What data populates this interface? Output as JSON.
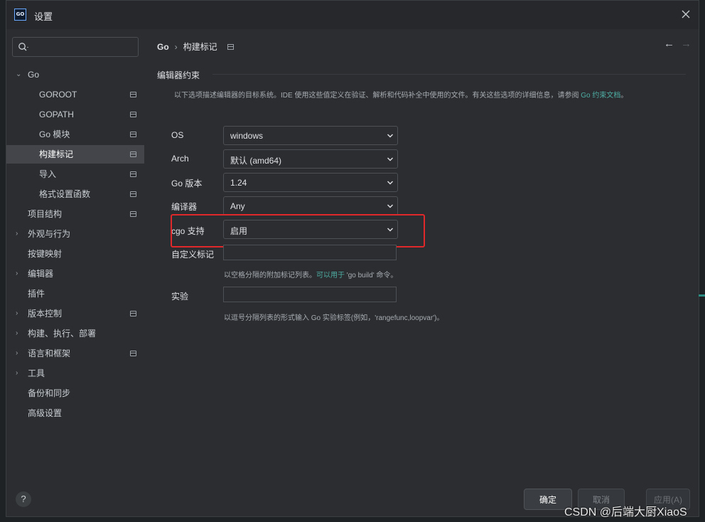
{
  "window": {
    "title": "设置",
    "app_icon_text": "GO"
  },
  "search": {
    "placeholder": ""
  },
  "sidebar": {
    "items": [
      {
        "label": "Go"
      },
      {
        "label": "GOROOT"
      },
      {
        "label": "GOPATH"
      },
      {
        "label": "Go 模块"
      },
      {
        "label": "构建标记"
      },
      {
        "label": "导入"
      },
      {
        "label": "格式设置函数"
      },
      {
        "label": "项目结构"
      },
      {
        "label": "外观与行为"
      },
      {
        "label": "按键映射"
      },
      {
        "label": "编辑器"
      },
      {
        "label": "插件"
      },
      {
        "label": "版本控制"
      },
      {
        "label": "构建、执行、部署"
      },
      {
        "label": "语言和框架"
      },
      {
        "label": "工具"
      },
      {
        "label": "备份和同步"
      },
      {
        "label": "高级设置"
      }
    ],
    "help": "?"
  },
  "breadcrumb": {
    "root": "Go",
    "sep": "›",
    "current": "构建标记"
  },
  "nav": {
    "back": "←",
    "forward": "→"
  },
  "section": {
    "title": "编辑器约束",
    "desc_prefix": "以下选项描述编辑器的目标系统。IDE 使用这些值定义在验证、解析和代码补全中使用的文件。有关这些选项的详细信息，请参阅 ",
    "desc_link": "Go 约束文档",
    "desc_suffix": "。"
  },
  "form": {
    "os": {
      "label": "OS",
      "value": "windows"
    },
    "arch": {
      "label": "Arch",
      "value": "默认 (amd64)"
    },
    "go_version": {
      "label": "Go 版本",
      "value": "1.24"
    },
    "compiler": {
      "label": "编译器",
      "value": "Any"
    },
    "cgo": {
      "label": "cgo 支持",
      "value": "启用"
    },
    "custom_tags": {
      "label": "自定义标记",
      "value": "",
      "hint_prefix": "以空格分隔的附加标记列表。",
      "hint_link": "可以用于",
      "hint_suffix": " 'go build' 命令。"
    },
    "experiment": {
      "label": "实验",
      "value": "",
      "hint": "以逗号分隔列表的形式输入 Go 实验标签(例如，'rangefunc,loopvar')。"
    }
  },
  "buttons": {
    "ok": "确定",
    "cancel": "取消",
    "apply": "应用(A)"
  },
  "watermark": "CSDN @后端大厨XiaoS",
  "colors": {
    "background": "#2b2d30",
    "selected": "#43454a",
    "link": "#4eaea4",
    "highlight": "#e0282a"
  }
}
